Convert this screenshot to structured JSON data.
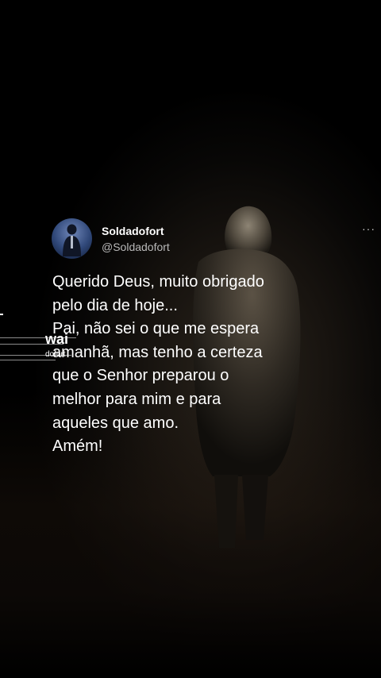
{
  "tweet": {
    "display_name": "Soldadofort",
    "handle": "@Soldadofort",
    "more_icon": "···",
    "lines": [
      "Querido Deus, muito obrigado",
      "pelo dia de hoje...",
      "Pai, não sei o que me espera",
      "amanhã, mas tenho a certeza",
      "que o Senhor preparou o",
      "melhor para mim e para",
      "aqueles que amo.",
      "Amém!"
    ]
  },
  "watermark": {
    "main": "wai",
    "sub": "dofort"
  },
  "icons": {
    "more": "more-icon",
    "avatar": "avatar"
  }
}
